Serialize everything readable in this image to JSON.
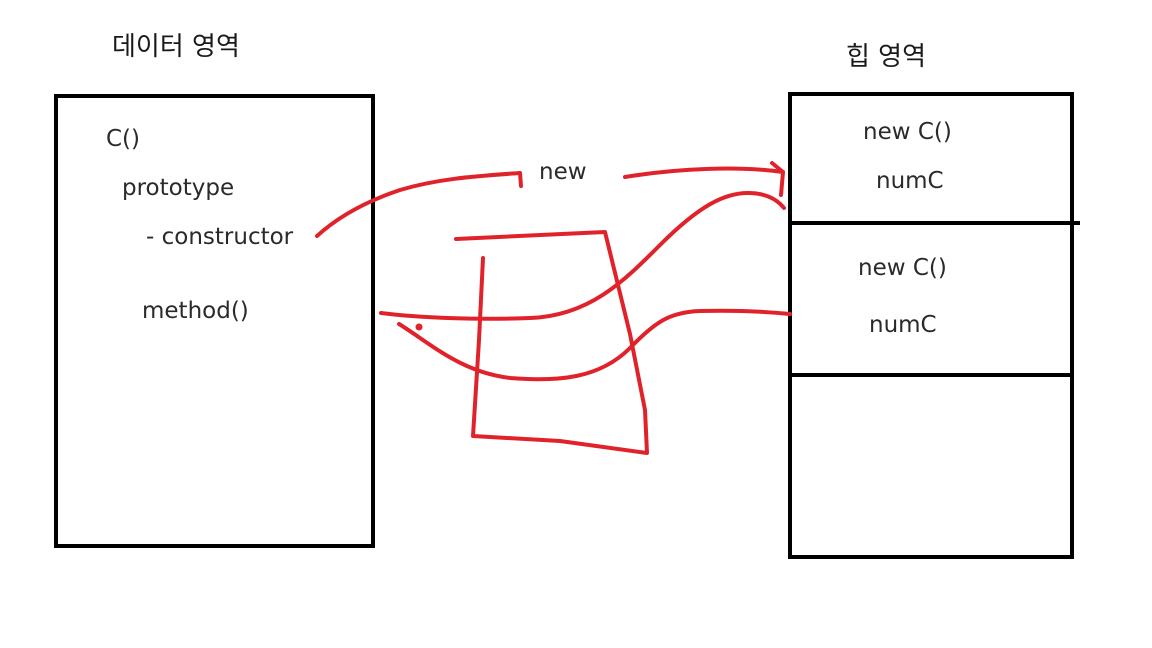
{
  "data_area": {
    "title": "데이터 영역",
    "items": {
      "c_func": "C()",
      "prototype": "prototype",
      "constructor": "- constructor",
      "method": "method()"
    }
  },
  "heap_area": {
    "title": "힙 영역",
    "instances": [
      {
        "label": "new C()",
        "field": "numC"
      },
      {
        "label": "new C()",
        "field": "numC"
      }
    ]
  },
  "annotation": {
    "new_label": "new"
  },
  "colors": {
    "box_stroke": "#000000",
    "arrow_ink": "#e0232b"
  }
}
